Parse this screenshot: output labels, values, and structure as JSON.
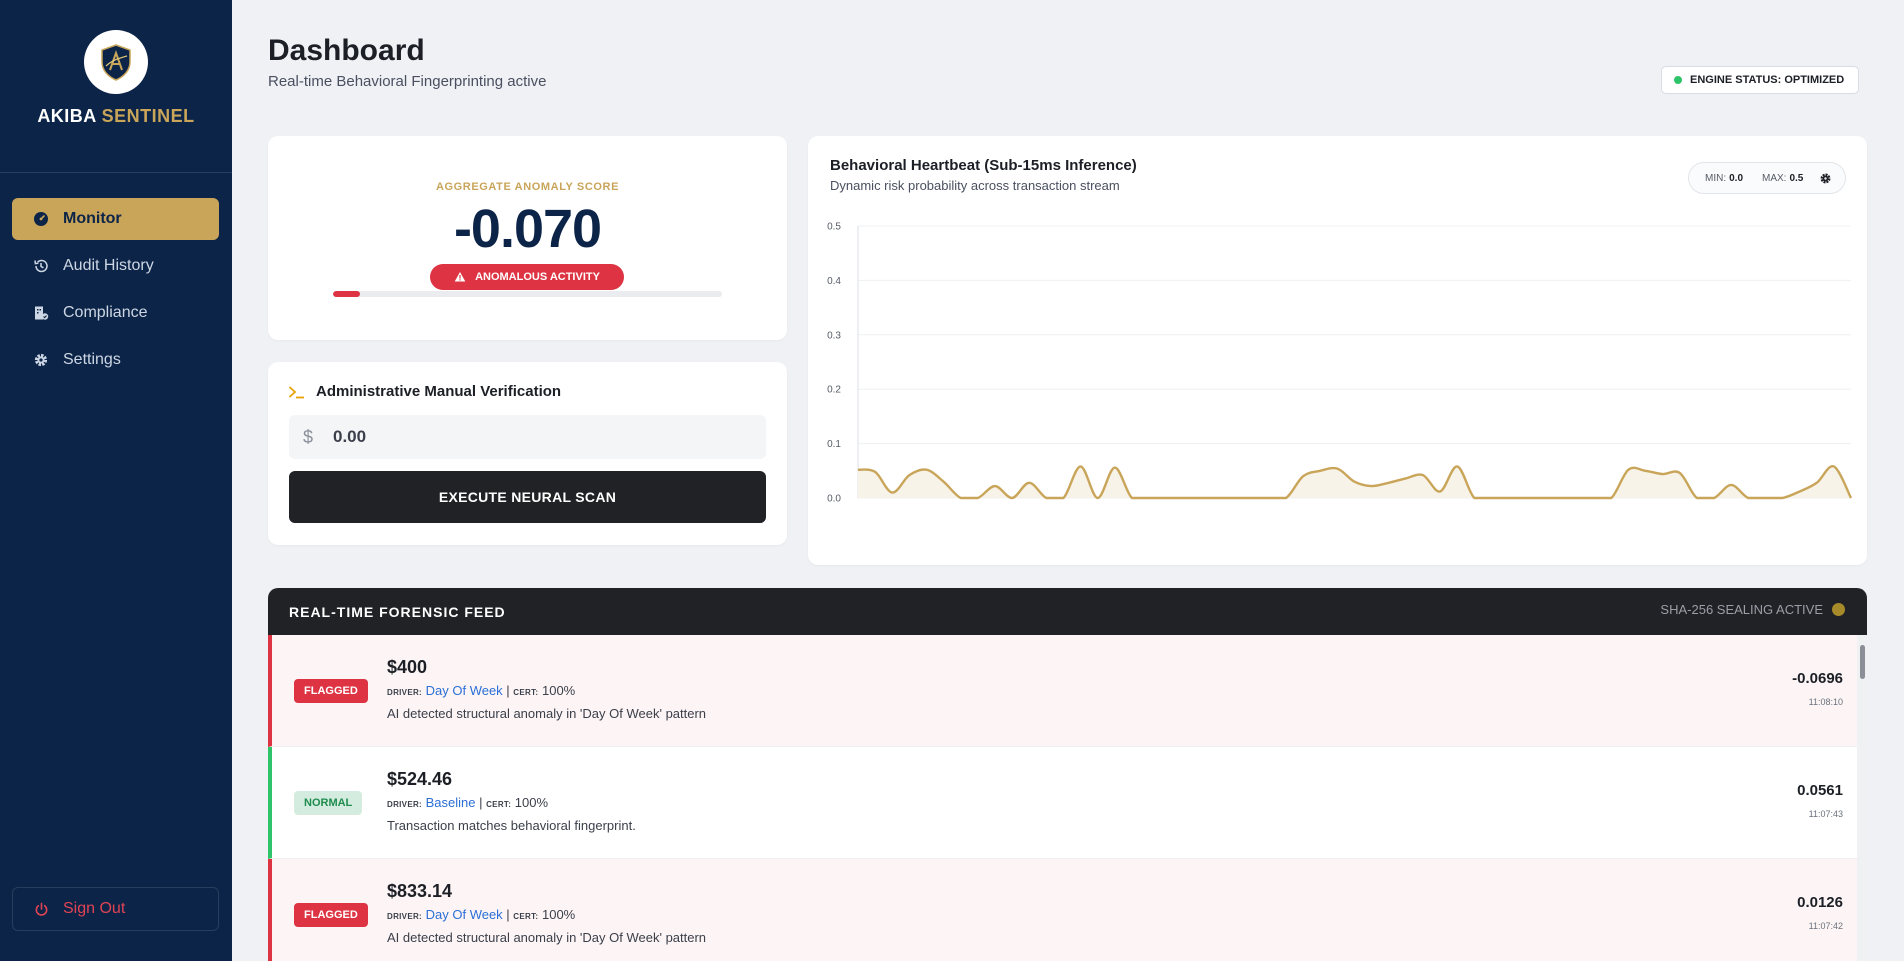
{
  "brand": {
    "name_part1": "AKIBA",
    "name_part2": "SENTINEL"
  },
  "sidebar": {
    "items": [
      {
        "label": "Monitor",
        "icon": "gauge-icon",
        "active": true
      },
      {
        "label": "Audit History",
        "icon": "history-icon",
        "active": false
      },
      {
        "label": "Compliance",
        "icon": "building-check-icon",
        "active": false
      },
      {
        "label": "Settings",
        "icon": "gear-icon",
        "active": false
      }
    ],
    "signout_label": "Sign Out"
  },
  "header": {
    "title": "Dashboard",
    "subtitle": "Real-time Behavioral Fingerprinting active",
    "engine_status": "ENGINE STATUS: OPTIMIZED"
  },
  "score": {
    "label": "AGGREGATE ANOMALY SCORE",
    "value": "-0.070",
    "status": "ANOMALOUS ACTIVITY",
    "bar_fraction": 0.07
  },
  "verify": {
    "title": "Administrative Manual Verification",
    "currency": "$",
    "amount_placeholder": "0.00",
    "button_label": "EXECUTE NEURAL SCAN"
  },
  "chart": {
    "title": "Behavioral Heartbeat (Sub-15ms Inference)",
    "subtitle": "Dynamic risk probability across transaction stream",
    "min_label": "MIN:",
    "min_value": "0.0",
    "max_label": "MAX:",
    "max_value": "0.5"
  },
  "chart_data": {
    "type": "area",
    "title": "Behavioral Heartbeat (Sub-15ms Inference)",
    "xlabel": "",
    "ylabel": "",
    "ylim": [
      0,
      0.5
    ],
    "yticks": [
      "0.0",
      "0.1",
      "0.2",
      "0.3",
      "0.4",
      "0.5"
    ],
    "grid": true,
    "line_color": "#c9a55a",
    "fill_color": "#f8f3e8",
    "values": [
      0.052,
      0.048,
      0.01,
      0.042,
      0.052,
      0.03,
      0.0,
      0.0,
      0.022,
      0.0,
      0.028,
      0.0,
      0.0,
      0.058,
      0.0,
      0.056,
      0.0,
      0.0,
      0.0,
      0.0,
      0.0,
      0.0,
      0.0,
      0.0,
      0.0,
      0.0,
      0.04,
      0.05,
      0.054,
      0.03,
      0.022,
      0.028,
      0.036,
      0.042,
      0.012,
      0.058,
      0.0,
      0.0,
      0.0,
      0.0,
      0.0,
      0.0,
      0.0,
      0.0,
      0.0,
      0.052,
      0.05,
      0.044,
      0.046,
      0.0,
      0.0,
      0.024,
      0.0,
      0.0,
      0.0,
      0.012,
      0.028,
      0.058,
      0.0
    ]
  },
  "feed": {
    "title": "REAL-TIME FORENSIC FEED",
    "sealing": "SHA-256 SEALING ACTIVE",
    "driver_key": "DRIVER:",
    "cert_key": "CERT:",
    "rows": [
      {
        "badge": "FLAGGED",
        "status": "flagged",
        "amount": "$400",
        "driver": "Day Of Week",
        "cert": "100%",
        "desc": "AI detected structural anomaly in 'Day Of Week' pattern",
        "score": "-0.0696",
        "time": "11:08:10"
      },
      {
        "badge": "NORMAL",
        "status": "normal",
        "amount": "$524.46",
        "driver": "Baseline",
        "cert": "100%",
        "desc": "Transaction matches behavioral fingerprint.",
        "score": "0.0561",
        "time": "11:07:43"
      },
      {
        "badge": "FLAGGED",
        "status": "flagged",
        "amount": "$833.14",
        "driver": "Day Of Week",
        "cert": "100%",
        "desc": "AI detected structural anomaly in 'Day Of Week' pattern",
        "score": "0.0126",
        "time": "11:07:42"
      }
    ]
  },
  "colors": {
    "sidebar_bg": "#0c2447",
    "accent_gold": "#c9a55a",
    "danger": "#dd3342",
    "success": "#2ec46a",
    "dark": "#212226"
  }
}
